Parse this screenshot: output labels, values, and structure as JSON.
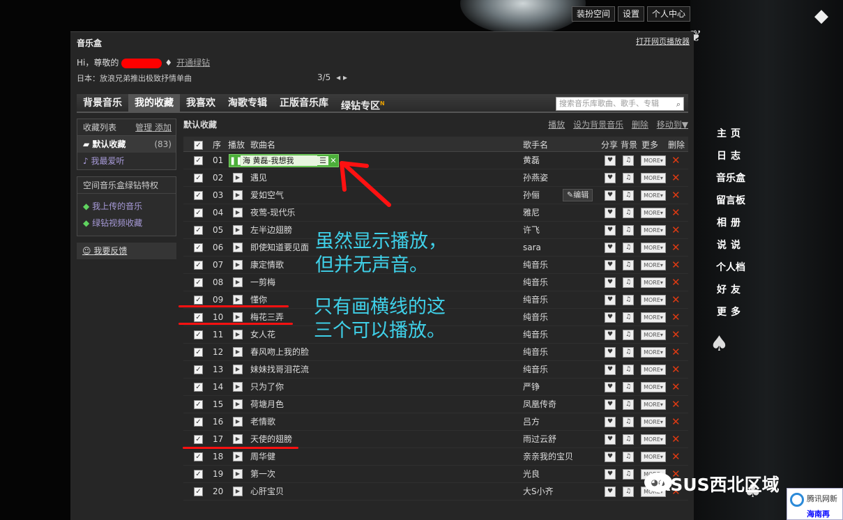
{
  "top_buttons": [
    "装扮空间",
    "设置",
    "个人中心"
  ],
  "panel": {
    "title": "音乐盒",
    "open_player": "打开网页播放器",
    "greeting": "Hi，尊敬的",
    "open_green": "开通绿钻",
    "news": "日本：放浪兄弟推出极致抒情单曲",
    "pager": "3/5"
  },
  "nav_tabs": [
    "背景音乐",
    "我的收藏",
    "我喜欢",
    "淘歌专辑",
    "正版音乐库",
    "绿钻专区"
  ],
  "nav_badge": "N",
  "search_placeholder": "搜索音乐库歌曲、歌手、专辑",
  "left_panel": {
    "list_title": "收藏列表",
    "manage": "管理",
    "add": "添加",
    "default_fav": "默认收藏",
    "default_count": "(83)",
    "i_like": "我最爱听",
    "privilege_title": "空间音乐盒绿钻特权",
    "uploaded": "我上传的音乐",
    "video_fav": "绿钻视频收藏",
    "feedback": "我要反馈"
  },
  "content": {
    "heading": "默认收藏",
    "actions": [
      "播放",
      "设为背景音乐",
      "删除",
      "移动到▼"
    ],
    "columns": {
      "index": "序",
      "play": "播放",
      "song": "歌曲名",
      "artist": "歌手名",
      "share": "分享",
      "bg": "背景",
      "more": "更多",
      "del": "删除"
    },
    "now_playing": "海 黄磊-我想我",
    "edit_label": "编辑",
    "more_label": "MORE",
    "rows": [
      {
        "idx": "01",
        "song": "",
        "artist": "黄磊"
      },
      {
        "idx": "02",
        "song": "遇见",
        "artist": "孙燕姿"
      },
      {
        "idx": "03",
        "song": "爱如空气",
        "artist": "孙俪"
      },
      {
        "idx": "04",
        "song": "夜莺-现代乐",
        "artist": "雅尼"
      },
      {
        "idx": "05",
        "song": "左半边翅膀",
        "artist": "许飞"
      },
      {
        "idx": "06",
        "song": "即使知道要见面",
        "artist": "sara"
      },
      {
        "idx": "07",
        "song": "康定情歌",
        "artist": "纯音乐"
      },
      {
        "idx": "08",
        "song": "一剪梅",
        "artist": "纯音乐"
      },
      {
        "idx": "09",
        "song": "懂你",
        "artist": "纯音乐"
      },
      {
        "idx": "10",
        "song": "梅花三弄",
        "artist": "纯音乐"
      },
      {
        "idx": "11",
        "song": "女人花",
        "artist": "纯音乐"
      },
      {
        "idx": "12",
        "song": "春风吻上我的脸",
        "artist": "纯音乐"
      },
      {
        "idx": "13",
        "song": "妹妹找哥泪花流",
        "artist": "纯音乐"
      },
      {
        "idx": "14",
        "song": "只为了你",
        "artist": "严铮"
      },
      {
        "idx": "15",
        "song": "荷塘月色",
        "artist": "凤凰传奇"
      },
      {
        "idx": "16",
        "song": "老情歌",
        "artist": "吕方"
      },
      {
        "idx": "17",
        "song": "天使的翅膀",
        "artist": "雨过云舒"
      },
      {
        "idx": "18",
        "song": "周华健",
        "artist": "亲亲我的宝贝"
      },
      {
        "idx": "19",
        "song": "第一次",
        "artist": "光良"
      },
      {
        "idx": "20",
        "song": "心肝宝贝",
        "artist": "大S小齐"
      }
    ]
  },
  "right_nav": [
    "主页",
    "日志",
    "音乐盒",
    "留言板",
    "相册",
    "说说",
    "个人档",
    "好友",
    "更多"
  ],
  "annotations": {
    "line1": "虽然显示播放，",
    "line2": "但并无声音。",
    "line3": "只有画横线的这",
    "line4": "三个可以播放。"
  },
  "watermark": "ASUS西北区域",
  "corner": {
    "t1": "腾讯网新",
    "t2": "海南再"
  },
  "colors": {
    "accent_red": "#ff1111",
    "annot": "#3fd0e8",
    "delete": "#e03a12",
    "playing": "#4caf3a"
  }
}
